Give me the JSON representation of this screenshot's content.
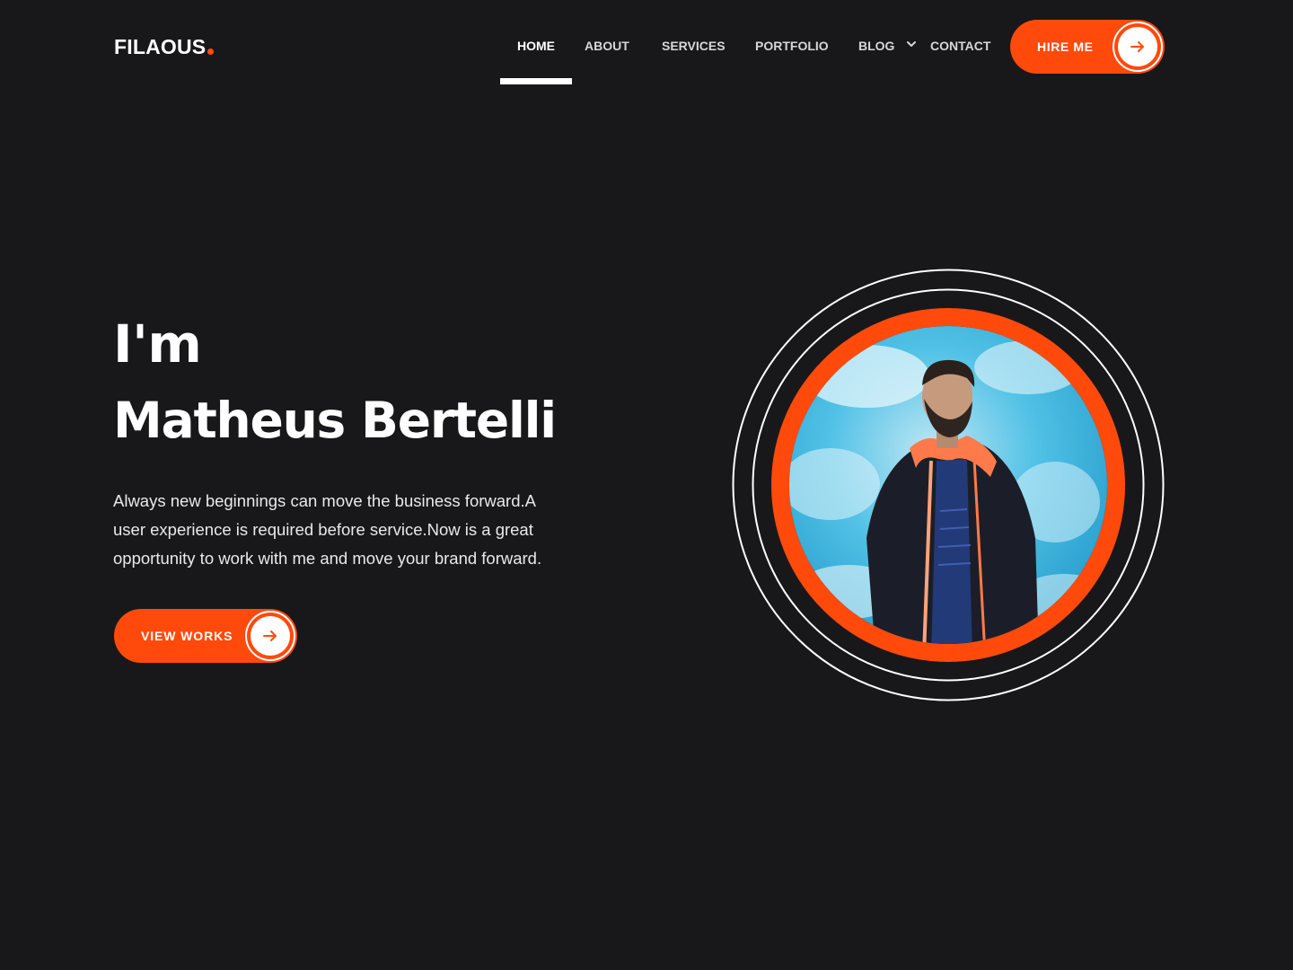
{
  "header": {
    "logo": "FILAOUS",
    "nav": {
      "home": "HOME",
      "about": "ABOUT",
      "services": "SERVICES",
      "portfolio": "PORTFOLIO",
      "blog": "BLOG",
      "contact": "CONTACT"
    },
    "active_nav": "HOME",
    "cta_label": "HIRE ME",
    "cta_icon": "arrow-right-icon"
  },
  "hero": {
    "intro": "I'm",
    "name": "Matheus Bertelli",
    "description": "Always new beginnings can move the business forward.A user experience is required before service.Now is a great opportunity to work with me and move your brand forward.",
    "cta_label": "VIEW WORKS",
    "cta_icon": "arrow-right-icon"
  },
  "colors": {
    "accent": "#ff4a0c",
    "background": "#18181b",
    "text": "#ffffff"
  }
}
